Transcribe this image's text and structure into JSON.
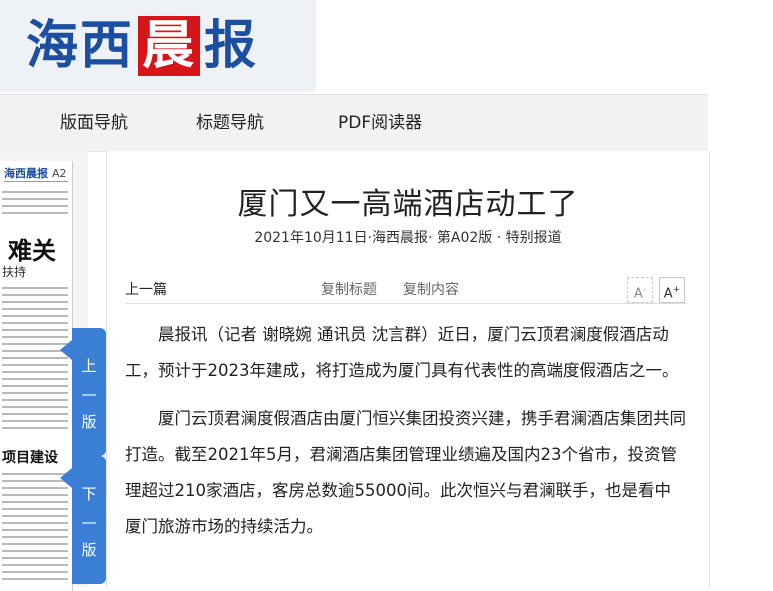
{
  "masthead": {
    "logo_part1": "海西",
    "logo_red": "晨",
    "logo_part2": "报"
  },
  "nav": {
    "items": [
      "版面导航",
      "标题导航",
      "PDF阅读器"
    ]
  },
  "thumbnail": {
    "header": "海西晨报",
    "page": "A2",
    "big_text": "难关",
    "sub_text": "扶持",
    "mid_text": "项目建设"
  },
  "page_tabs": {
    "prev": "上\n—\n版",
    "next": "下\n—\n版"
  },
  "article": {
    "title": "厦门又一高端酒店动工了",
    "meta": "2021年10月11日·海西晨报· 第A02版 · 特别报道",
    "toolbar": {
      "prev_article": "上一篇",
      "copy_title": "复制标题",
      "copy_content": "复制内容",
      "font_smaller": "A",
      "font_smaller_sup": "-",
      "font_larger": "A",
      "font_larger_sup": "+"
    },
    "paragraphs": [
      "晨报讯（记者 谢晓婉 通讯员 沈言群）近日，厦门云顶君澜度假酒店动工，预计于2023年建成，将打造成为厦门具有代表性的高端度假酒店之一。",
      "厦门云顶君澜度假酒店由厦门恒兴集团投资兴建，携手君澜酒店集团共同打造。截至2021年5月，君澜酒店集团管理业绩遍及国内23个省市，投资管理超过210家酒店，客房总数逾55000间。此次恒兴与君澜联手，也是看中厦门旅游市场的持续活力。"
    ]
  }
}
